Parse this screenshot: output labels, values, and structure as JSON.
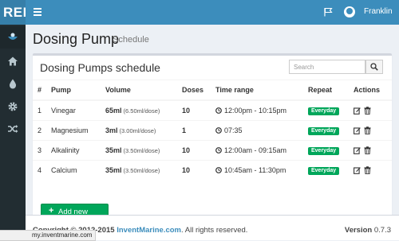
{
  "app": {
    "logo_text": "REE"
  },
  "topbar": {
    "user_name": "Franklin"
  },
  "sidebar": {
    "items": [
      {
        "icon": "app-logo-icon"
      },
      {
        "icon": "home-icon"
      },
      {
        "icon": "water-drop-icon"
      },
      {
        "icon": "gear-icon"
      },
      {
        "icon": "random-icon"
      }
    ]
  },
  "page": {
    "title": "Dosing Pump",
    "subtitle": "Schedule"
  },
  "box": {
    "title": "Dosing Pumps schedule",
    "search_placeholder": "Search"
  },
  "table": {
    "columns": [
      "#",
      "Pump",
      "Volume",
      "Doses",
      "Time range",
      "Repeat",
      "Actions"
    ],
    "rows": [
      {
        "num": "1",
        "pump": "Vinegar",
        "volume": "65ml",
        "per_dose": "(6.50ml/dose)",
        "doses": "10",
        "time": "12:00pm - 10:15pm",
        "repeat": "Everyday"
      },
      {
        "num": "2",
        "pump": "Magnesium",
        "volume": "3ml",
        "per_dose": "(3.00ml/dose)",
        "doses": "1",
        "time": "07:35",
        "repeat": "Everyday"
      },
      {
        "num": "3",
        "pump": "Alkalinity",
        "volume": "35ml",
        "per_dose": "(3.50ml/dose)",
        "doses": "10",
        "time": "12:00am - 09:15am",
        "repeat": "Everyday"
      },
      {
        "num": "4",
        "pump": "Calcium",
        "volume": "35ml",
        "per_dose": "(3.50ml/dose)",
        "doses": "10",
        "time": "10:45am - 11:30pm",
        "repeat": "Everyday"
      }
    ]
  },
  "add_button": {
    "label": "Add new"
  },
  "footer": {
    "copyright_prefix": "Copyright © 2012-2015 ",
    "link": "InventMarine.com",
    "suffix": ". All rights reserved.",
    "version_label": "Version",
    "version": "0.7.3"
  },
  "status_url": "my.inventmarine.com",
  "colors": {
    "header": "#3c8dbc",
    "sidebar": "#222d32",
    "success": "#00a65a",
    "background": "#ecf0f5"
  }
}
